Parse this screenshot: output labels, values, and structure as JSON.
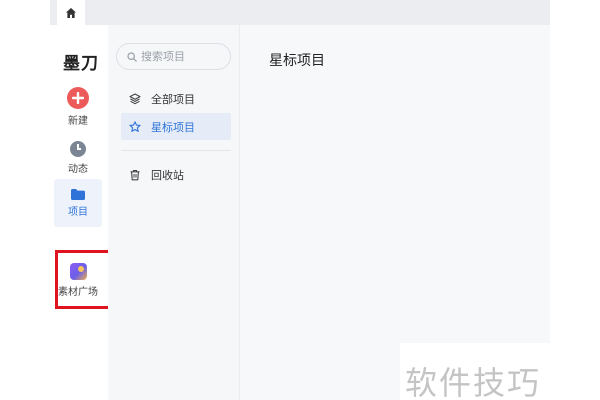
{
  "app": {
    "logo": "墨刀"
  },
  "rail": {
    "new_label": "新建",
    "activity_label": "动态",
    "projects_label": "项目",
    "material_label": "素材广场"
  },
  "sidebar": {
    "search_placeholder": "搜索项目",
    "items": [
      {
        "label": "全部项目"
      },
      {
        "label": "星标项目"
      },
      {
        "label": "回收站"
      }
    ]
  },
  "main": {
    "title": "星标项目"
  },
  "watermark": "软件技巧",
  "colors": {
    "accent": "#2f73d8",
    "new_button": "#ec5a5a",
    "highlight": "#e0141e"
  }
}
